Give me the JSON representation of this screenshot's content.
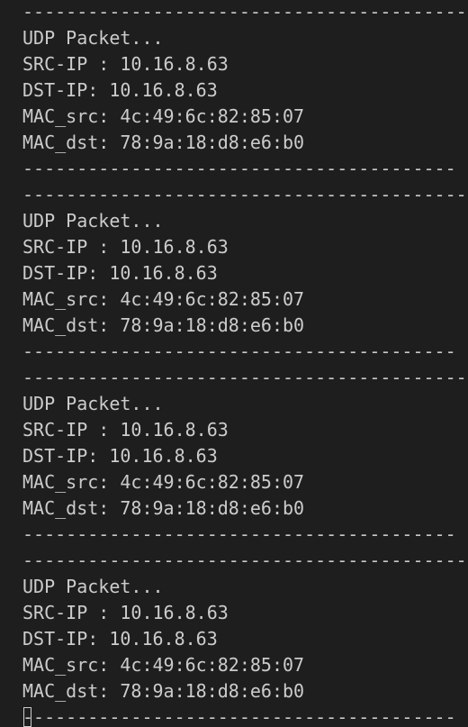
{
  "terminal": {
    "lines": [
      {
        "kind": "sep",
        "text": "------------------------------------------"
      },
      {
        "kind": "text",
        "text": "UDP Packet..."
      },
      {
        "kind": "text",
        "text": "SRC-IP : 10.16.8.63"
      },
      {
        "kind": "text",
        "text": "DST-IP: 10.16.8.63"
      },
      {
        "kind": "text",
        "text": "MAC_src: 4c:49:6c:82:85:07"
      },
      {
        "kind": "text",
        "text": "MAC_dst: 78:9a:18:d8:e6:b0"
      },
      {
        "kind": "sep",
        "text": "----------------------------------------"
      },
      {
        "kind": "sep",
        "text": "------------------------------------------"
      },
      {
        "kind": "text",
        "text": "UDP Packet..."
      },
      {
        "kind": "text",
        "text": "SRC-IP : 10.16.8.63"
      },
      {
        "kind": "text",
        "text": "DST-IP: 10.16.8.63"
      },
      {
        "kind": "text",
        "text": "MAC_src: 4c:49:6c:82:85:07"
      },
      {
        "kind": "text",
        "text": "MAC_dst: 78:9a:18:d8:e6:b0"
      },
      {
        "kind": "sep",
        "text": "----------------------------------------"
      },
      {
        "kind": "sep",
        "text": "------------------------------------------"
      },
      {
        "kind": "text",
        "text": "UDP Packet..."
      },
      {
        "kind": "text",
        "text": "SRC-IP : 10.16.8.63"
      },
      {
        "kind": "text",
        "text": "DST-IP: 10.16.8.63"
      },
      {
        "kind": "text",
        "text": "MAC_src: 4c:49:6c:82:85:07"
      },
      {
        "kind": "text",
        "text": "MAC_dst: 78:9a:18:d8:e6:b0"
      },
      {
        "kind": "sep",
        "text": "----------------------------------------"
      },
      {
        "kind": "sep",
        "text": "------------------------------------------"
      },
      {
        "kind": "text",
        "text": "UDP Packet..."
      },
      {
        "kind": "text",
        "text": "SRC-IP : 10.16.8.63"
      },
      {
        "kind": "text",
        "text": "DST-IP: 10.16.8.63"
      },
      {
        "kind": "text",
        "text": "MAC_src: 4c:49:6c:82:85:07"
      },
      {
        "kind": "text",
        "text": "MAC_dst: 78:9a:18:d8:e6:b0"
      },
      {
        "kind": "cursor-sep",
        "text": "----------------------------------------"
      }
    ]
  },
  "colors": {
    "background": "#1e1e1e",
    "foreground": "#cccccc"
  }
}
